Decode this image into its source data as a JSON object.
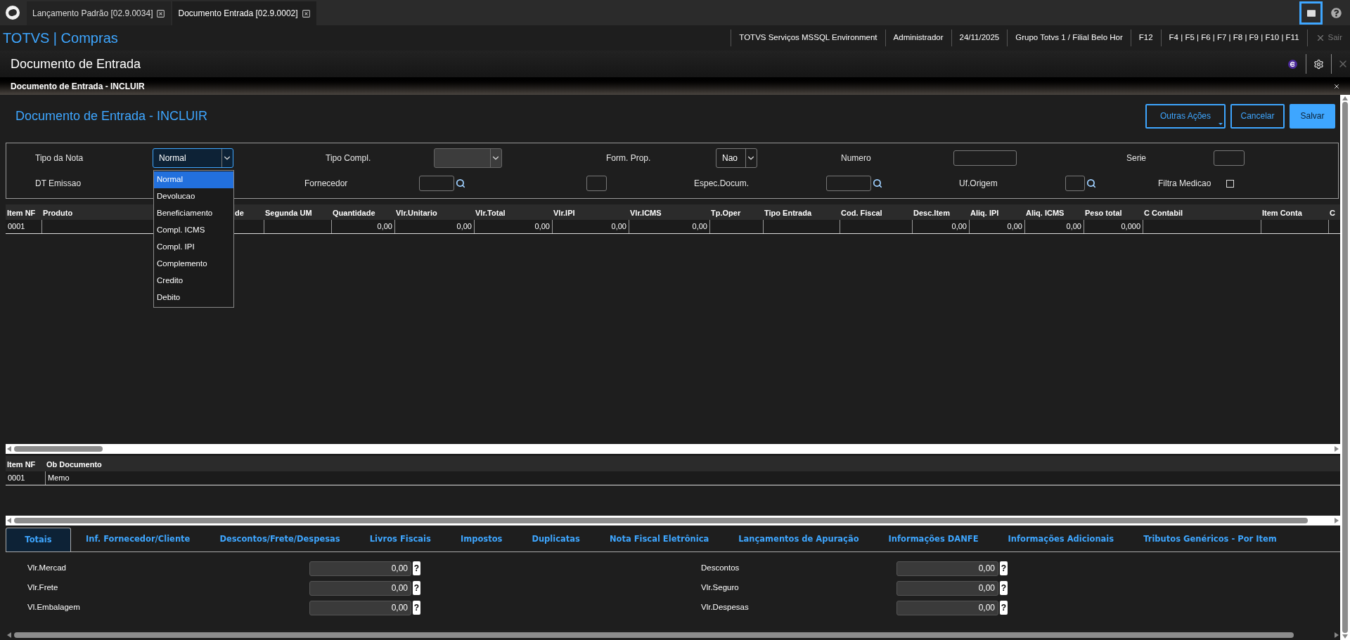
{
  "app_tabs": [
    {
      "label": "Lançamento Padrão [02.9.0034]",
      "selected": false
    },
    {
      "label": "Documento Entrada [02.9.0002]",
      "selected": true
    }
  ],
  "app_title": "TOTVS | Compras",
  "session_info": [
    "TOTVS Serviços MSSQL Environment",
    "Administrador",
    "24/11/2025",
    "Grupo Totvs 1 / Filial Belo Hor",
    "F12",
    "F4 | F5 | F6 | F7 | F8 | F9 | F10 | F11"
  ],
  "exit": {
    "label": "Sair",
    "disabled": true
  },
  "page_title": "Documento de Entrada",
  "dialog_bar_title": "Documento de Entrada - INCLUIR",
  "form_title": "Documento de Entrada - INCLUIR",
  "actions": [
    {
      "label": "Outras Ações",
      "kind": "menu"
    },
    {
      "label": "Cancelar",
      "kind": "outline"
    },
    {
      "label": "Salvar",
      "kind": "primary"
    }
  ],
  "header_fields": [
    [
      {
        "kind": "label",
        "text": "Tipo da Nota"
      },
      {
        "kind": "select",
        "value": "Normal",
        "open": true
      },
      {
        "kind": "label",
        "text": "Tipo Compl."
      },
      {
        "kind": "select",
        "disabled": true
      },
      {
        "kind": "label",
        "text": "Form. Prop."
      },
      {
        "kind": "select",
        "value": "Nao",
        "open": false
      },
      {
        "kind": "label",
        "text": "Numero"
      },
      {
        "kind": "input"
      },
      {
        "kind": "label",
        "text": "Serie"
      },
      {
        "kind": "input"
      }
    ],
    [
      {
        "kind": "label",
        "text": "DT Emissao"
      },
      {
        "kind": "label",
        "text": "Fornecedor"
      },
      {
        "kind": "lookup"
      },
      {
        "kind": "input"
      },
      {
        "kind": "label",
        "text": "Espec.Docum."
      },
      {
        "kind": "lookup"
      },
      {
        "kind": "label",
        "text": "Uf.Origem"
      },
      {
        "kind": "lookup"
      },
      {
        "kind": "label",
        "text": "Filtra Medicao"
      },
      {
        "kind": "checkbox",
        "checked": false
      }
    ]
  ],
  "open_dropdown": {
    "options": [
      {
        "label": "Normal",
        "selected": true
      },
      {
        "label": "Devolucao",
        "selected": false
      },
      {
        "label": "Beneficiamento",
        "selected": false
      },
      {
        "label": "Compl. ICMS",
        "selected": false
      },
      {
        "label": "Compl. IPI",
        "selected": false
      },
      {
        "label": "Complemento",
        "selected": false
      },
      {
        "label": "Credito",
        "selected": false
      },
      {
        "label": "Debito",
        "selected": false
      }
    ]
  },
  "items_grid": {
    "columns": [
      "Item NF",
      "Produto",
      "de",
      "Segunda UM",
      "Quantidade",
      "Vlr.Unitario",
      "Vlr.Total",
      "Vlr.IPI",
      "Vlr.ICMS",
      "Tp.Oper",
      "Tipo Entrada",
      "Cod. Fiscal",
      "Desc.Item",
      "Aliq. IPI",
      "Aliq. ICMS",
      "Peso total",
      "C Contabil",
      "Item Conta",
      "C"
    ],
    "rows": [
      {
        "cells": [
          "0001",
          null,
          null,
          null,
          "0,00",
          "0,00",
          "0,00",
          "0,00",
          "0,00",
          null,
          null,
          null,
          "0,00",
          "0,00",
          "0,00",
          "0,000",
          null,
          null,
          null
        ]
      }
    ]
  },
  "notes_grid": {
    "columns": [
      "Item NF",
      "Ob Documento"
    ],
    "rows": [
      {
        "cells": [
          "0001",
          "Memo"
        ]
      }
    ]
  },
  "bottom_tabs": [
    {
      "label": "Totais",
      "selected": true
    },
    {
      "label": "Inf. Fornecedor/Cliente",
      "selected": false
    },
    {
      "label": "Descontos/Frete/Despesas",
      "selected": false
    },
    {
      "label": "Livros Fiscais",
      "selected": false
    },
    {
      "label": "Impostos",
      "selected": false
    },
    {
      "label": "Duplicatas",
      "selected": false
    },
    {
      "label": "Nota Fiscal Eletrônica",
      "selected": false
    },
    {
      "label": "Lançamentos de Apuração",
      "selected": false
    },
    {
      "label": "Informações DANFE",
      "selected": false
    },
    {
      "label": "Informações Adicionais",
      "selected": false
    },
    {
      "label": "Tributos Genéricos - Por Item",
      "selected": false
    }
  ],
  "totals": [
    [
      {
        "label": "Vlr.Mercad",
        "value": "0,00",
        "help": "?"
      },
      {
        "label": "Descontos",
        "value": "0,00",
        "help": "?"
      }
    ],
    [
      {
        "label": "Vlr.Frete",
        "value": "0,00",
        "help": "?"
      },
      {
        "label": "Vlr.Seguro",
        "value": "0,00",
        "help": "?"
      }
    ],
    [
      {
        "label": "Vl.Embalagem",
        "value": "0,00",
        "help": "?"
      },
      {
        "label": "Vlr.Despesas",
        "value": "0,00",
        "help": "?"
      }
    ]
  ]
}
